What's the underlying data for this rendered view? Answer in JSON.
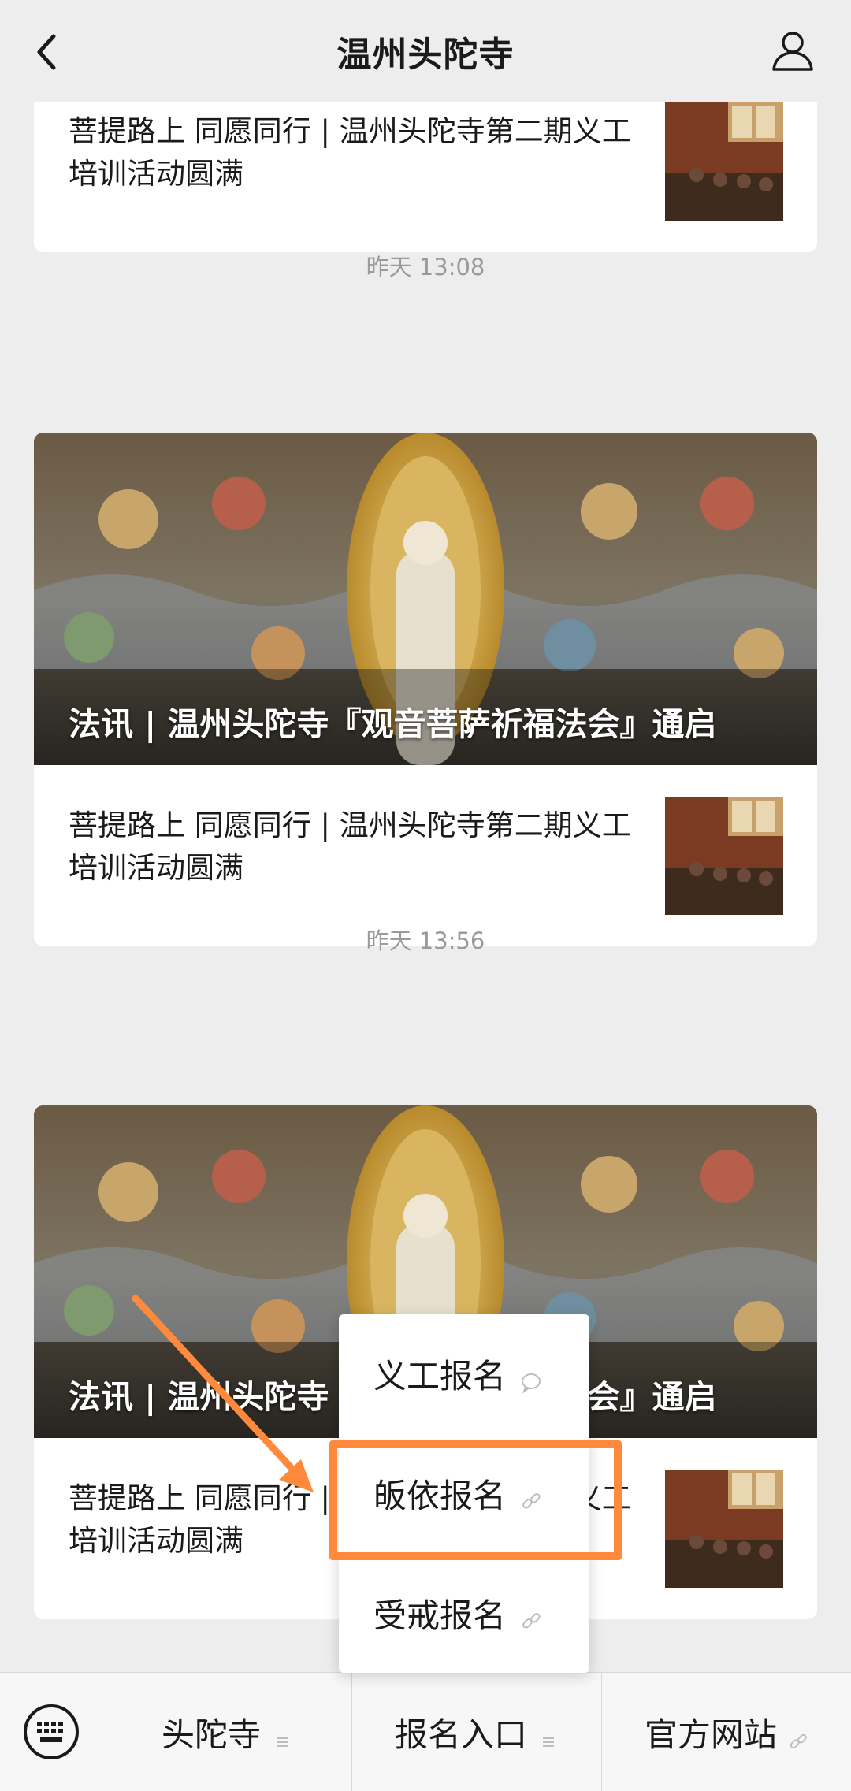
{
  "header": {
    "title": "温州头陀寺"
  },
  "feed": {
    "partial_card": {
      "sub_title": "菩提路上 同愿同行 | 温州头陀寺第二期义工培训活动圆满"
    },
    "groups": [
      {
        "time": "昨天 13:08",
        "cover_title": "法讯 | 温州头陀寺『观音菩萨祈福法会』通启",
        "sub_title": "菩提路上 同愿同行 | 温州头陀寺第二期义工培训活动圆满"
      },
      {
        "time": "昨天 13:56",
        "cover_title": "法讯 | 温州头陀寺『观音菩萨祈福法会』通启",
        "sub_title": "菩提路上 同愿同行 | 温州头陀寺第二期义工培训活动圆满"
      }
    ]
  },
  "popup": {
    "items": [
      {
        "label": "义工报名",
        "icon": "message-icon"
      },
      {
        "label": "皈依报名",
        "icon": "link-icon"
      },
      {
        "label": "受戒报名",
        "icon": "link-icon"
      }
    ]
  },
  "bottom_menu": {
    "items": [
      {
        "label": "头陀寺",
        "icon": "menu-lines-icon"
      },
      {
        "label": "报名入口",
        "icon": "menu-lines-icon"
      },
      {
        "label": "官方网站",
        "icon": "link-icon"
      }
    ]
  },
  "colors": {
    "highlight": "#ff8a3c",
    "background": "#ededed"
  }
}
